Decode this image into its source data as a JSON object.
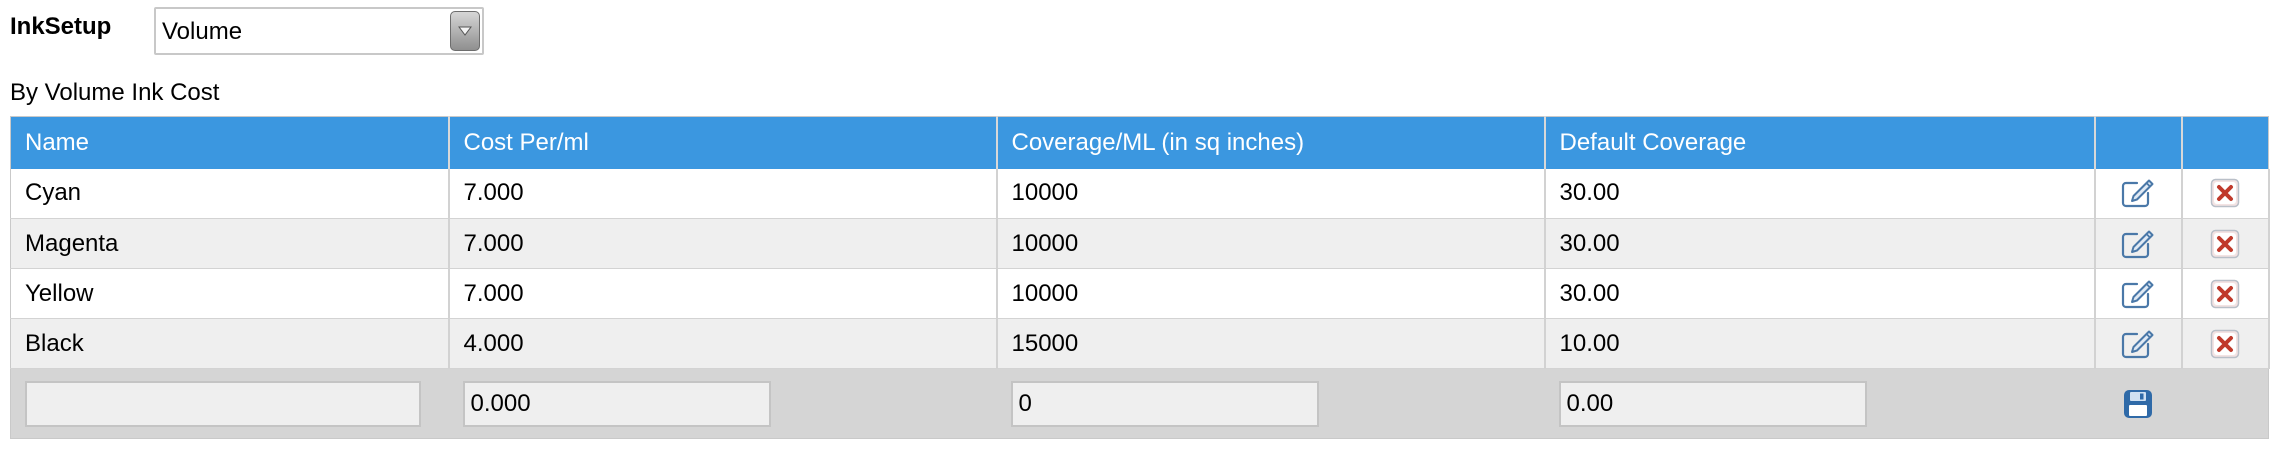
{
  "ink_setup": {
    "label": "InkSetup",
    "selected": "Volume"
  },
  "section_title": "By Volume Ink Cost",
  "table": {
    "headers": [
      "Name",
      "Cost Per/ml",
      "Coverage/ML (in sq inches)",
      "Default Coverage"
    ],
    "rows": [
      {
        "name": "Cyan",
        "cost": "7.000",
        "coverage": "10000",
        "default": "30.00"
      },
      {
        "name": "Magenta",
        "cost": "7.000",
        "coverage": "10000",
        "default": "30.00"
      },
      {
        "name": "Yellow",
        "cost": "7.000",
        "coverage": "10000",
        "default": "30.00"
      },
      {
        "name": "Black",
        "cost": "4.000",
        "coverage": "15000",
        "default": "10.00"
      }
    ],
    "new_row": {
      "name": "",
      "cost": "0.000",
      "coverage": "0",
      "default": "0.00"
    }
  },
  "icons": {
    "edit": "edit-icon",
    "delete": "delete-icon",
    "save": "save-icon",
    "dropdown": "chevron-down-icon"
  },
  "colors": {
    "header_bg": "#3b97e0",
    "edit_icon": "#4a78a8",
    "delete_icon": "#c0392b",
    "save_icon": "#2f6aa8"
  }
}
